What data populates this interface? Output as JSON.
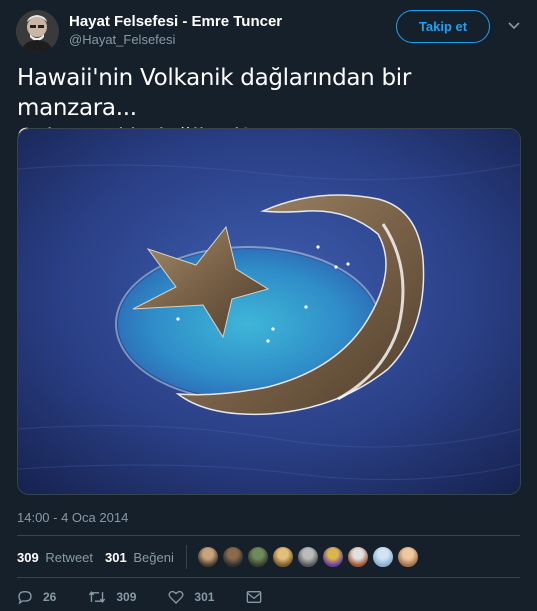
{
  "author": {
    "name": "Hayat Felsefesi - Emre Tuncer",
    "handle": "@Hayat_Felsefesi"
  },
  "follow_label": "Takip et",
  "tweet": {
    "line1": "Hawaii'nin Volkanik dağlarından bir manzara...",
    "line2": "Çok tanıdık değil mi?"
  },
  "timestamp": "14:00 - 4 Oca 2014",
  "stats": {
    "retweets_count": "309",
    "retweets_label": "Retweet",
    "likes_count": "301",
    "likes_label": "Beğeni"
  },
  "actions": {
    "reply_count": "26",
    "retweet_count": "309",
    "like_count": "301"
  },
  "colors": {
    "background": "#15202b",
    "accent": "#1da1f2",
    "muted": "#8899a6",
    "border": "#38444d"
  },
  "icons": [
    "chevron-down-icon",
    "reply-icon",
    "retweet-icon",
    "heart-icon",
    "envelope-icon"
  ]
}
